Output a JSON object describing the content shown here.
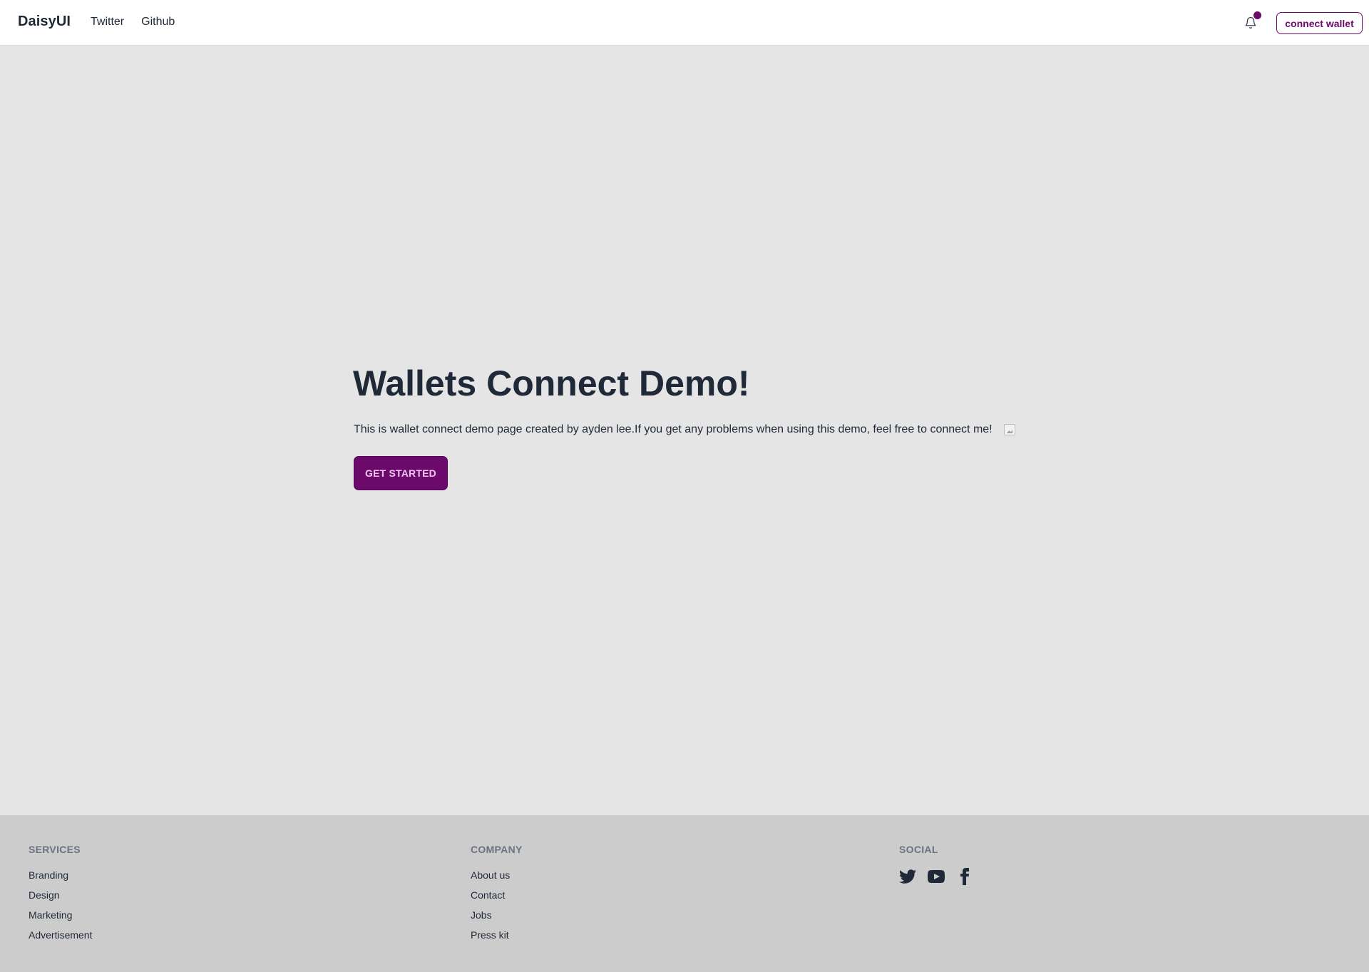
{
  "navbar": {
    "brand": "DaisyUI",
    "links": [
      {
        "label": "Twitter"
      },
      {
        "label": "Github"
      }
    ],
    "connect_label": "connect wallet",
    "icons": {
      "notification": "bell-icon"
    },
    "colors": {
      "primary": "#6b0a6b"
    }
  },
  "hero": {
    "title": "Wallets Connect Demo!",
    "description": "This is wallet connect demo page created by ayden lee.If you get any problems when using this demo, feel free to connect me!",
    "cta_label": "GET STARTED"
  },
  "footer": {
    "services": {
      "title": "SERVICES",
      "links": [
        "Branding",
        "Design",
        "Marketing",
        "Advertisement"
      ]
    },
    "company": {
      "title": "COMPANY",
      "links": [
        "About us",
        "Contact",
        "Jobs",
        "Press kit"
      ]
    },
    "social": {
      "title": "SOCIAL",
      "icons": [
        "twitter-icon",
        "youtube-icon",
        "facebook-icon"
      ]
    }
  }
}
